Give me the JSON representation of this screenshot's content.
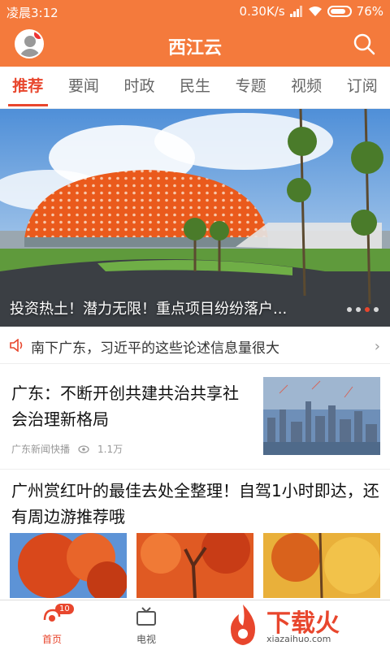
{
  "status_bar": {
    "time": "凌晨3:12",
    "speed": "0.30K/s",
    "battery": "76%"
  },
  "app_bar": {
    "title": "西江云"
  },
  "tabs": [
    {
      "label": "推荐",
      "active": true
    },
    {
      "label": "要闻"
    },
    {
      "label": "时政"
    },
    {
      "label": "民生"
    },
    {
      "label": "专题"
    },
    {
      "label": "视频"
    },
    {
      "label": "订阅"
    }
  ],
  "hero": {
    "caption": "投资热土！潜力无限！重点项目纷纷落户..."
  },
  "ticker": {
    "text": "南下广东，习近平的这些论述信息量很大"
  },
  "articles": [
    {
      "headline": "广东：不断开创共建共治共享社会治理新格局",
      "source": "广东新闻快播",
      "views": "1.1万"
    },
    {
      "headline": "广州赏红叶的最佳去处全整理！自驾1小时即达，还有周边游推荐哦"
    }
  ],
  "bottom_nav": {
    "home_label": "首页",
    "home_badge": "10",
    "tv_label": "电视"
  },
  "watermark": {
    "text": "下载火",
    "url": "xiazaihuo.com"
  },
  "colors": {
    "brand": "#f47a3c",
    "accent": "#e8462d"
  }
}
